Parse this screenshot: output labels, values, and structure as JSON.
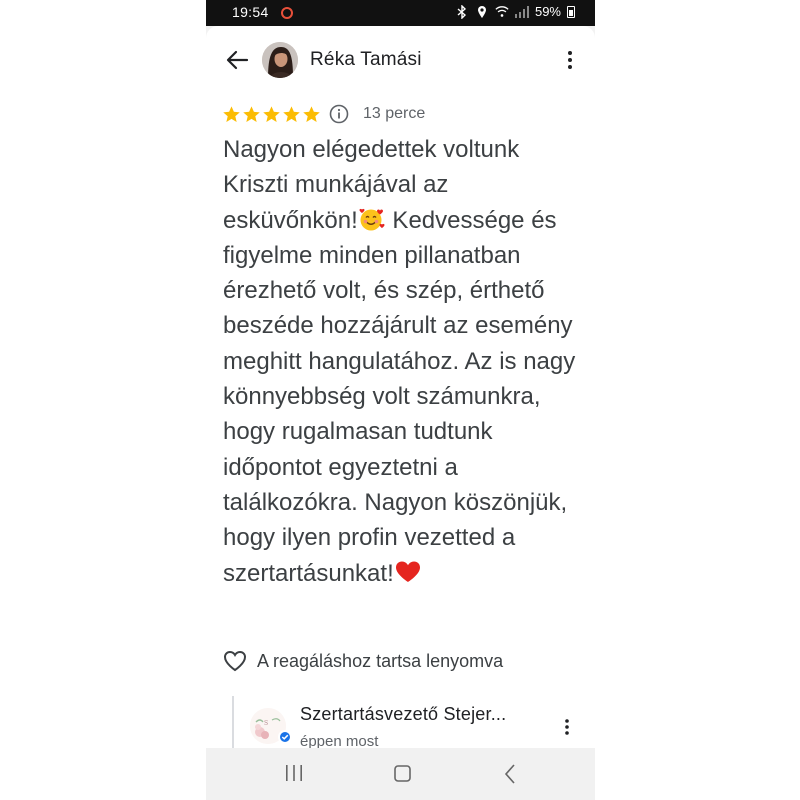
{
  "status_bar": {
    "time": "19:54",
    "battery": "59%"
  },
  "header": {
    "reviewer_name": "Réka Tamási",
    "back_icon": "arrow-left-icon",
    "menu_icon": "more-vert-icon"
  },
  "review": {
    "stars": 5,
    "star_color": "#fbbc04",
    "time_ago": "13 perce",
    "text_before_emoji": "Nagyon elégedettek voltunk Kriszti munkájával az esküvőnkön!",
    "emoji_1": "smiling-face-with-hearts",
    "text_middle": " Kedvessége és figyelme minden pillanatban érezhető volt, és szép, érthető beszéde hozzájárult az esemény meghitt hangulatához. Az is nagy könnyebbség volt számunkra, hogy rugalmasan tudtunk időpontot egyeztetni a találkozókra. Nagyon köszönjük, hogy ilyen profin vezetted a szertartásunkat!",
    "emoji_2": "red-heart"
  },
  "reaction": {
    "label": "A reagáláshoz tartsa lenyomva"
  },
  "owner_reply": {
    "name": "Szertartásvezető Stejer...",
    "time": "éppen most",
    "verified_color": "#1a73e8"
  },
  "colors": {
    "accent": "#1a73e8",
    "star": "#fbbc04",
    "heart": "#e5251f"
  }
}
